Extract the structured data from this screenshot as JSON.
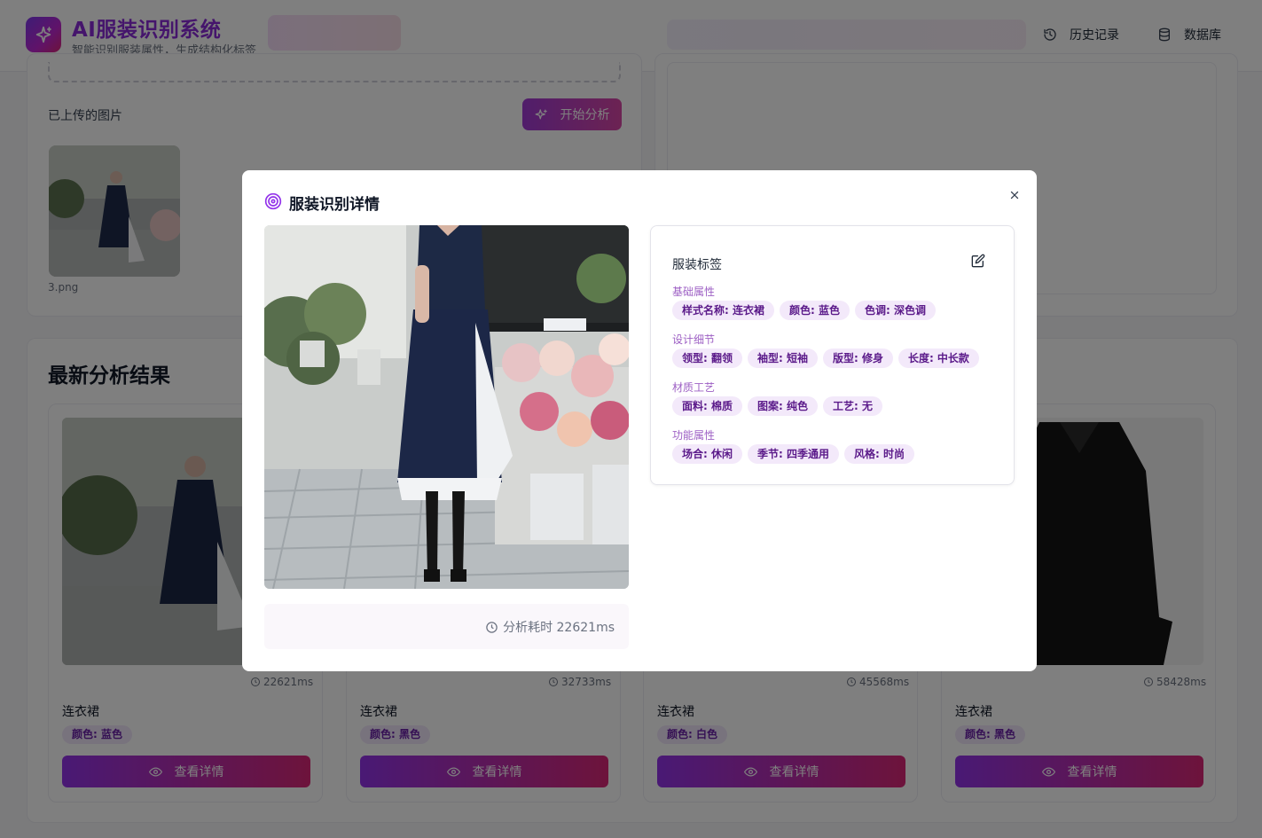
{
  "header": {
    "title": "AI服装识别系统",
    "subtitle": "智能识别服装属性，生成结构化标签",
    "history_label": "历史记录",
    "database_label": "数据库"
  },
  "upload": {
    "uploaded_label": "已上传的图片",
    "start_label": "开始分析",
    "file_name": "3.png"
  },
  "results": {
    "title": "最新分析结果",
    "view_label": "查看详情",
    "cards": [
      {
        "time": "22621ms",
        "name": "连衣裙",
        "chip": "颜色: 蓝色"
      },
      {
        "time": "32733ms",
        "name": "连衣裙",
        "chip": "颜色: 黑色"
      },
      {
        "time": "45568ms",
        "name": "连衣裙",
        "chip": "颜色: 白色"
      },
      {
        "time": "58428ms",
        "name": "连衣裙",
        "chip": "颜色: 黑色"
      }
    ]
  },
  "modal": {
    "title": "服装识别详情",
    "analysis_time": "分析耗时 22621ms",
    "tags_title": "服装标签",
    "groups": [
      {
        "label": "基础属性",
        "tags": [
          "样式名称: 连衣裙",
          "颜色: 蓝色",
          "色调: 深色调"
        ]
      },
      {
        "label": "设计细节",
        "tags": [
          "领型: 翻领",
          "袖型: 短袖",
          "版型: 修身",
          "长度: 中长款"
        ]
      },
      {
        "label": "材质工艺",
        "tags": [
          "面料: 棉质",
          "图案: 纯色",
          "工艺: 无"
        ]
      },
      {
        "label": "功能属性",
        "tags": [
          "场合: 休闲",
          "季节: 四季通用",
          "风格: 时尚"
        ]
      }
    ]
  },
  "colors": {
    "accent": "#9333ea",
    "accent_pink": "#db2777",
    "chip_bg": "#f3e9fa",
    "chip_text": "#5b1a8a"
  }
}
